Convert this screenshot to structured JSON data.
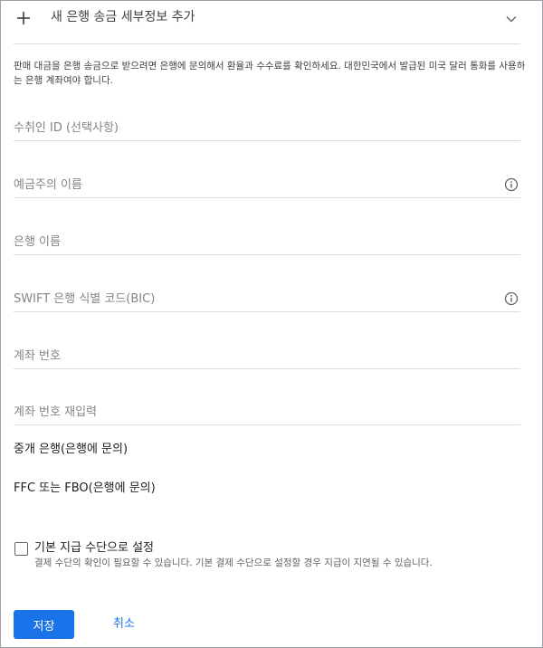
{
  "header": {
    "title": "새 은행 송금 세부정보 추가",
    "expand_icon": "plus-icon",
    "collapse_icon": "chevron-down-icon"
  },
  "description": "판매 대금을 은행 송금으로 받으려면 은행에 문의해서 환율과 수수료를 확인하세요. 대한민국에서 발급된 미국 달러 통화를 사용하는 은행 계좌여야 합니다.",
  "form": {
    "recipient_id": {
      "placeholder": "수취인 ID (선택사항)",
      "value": ""
    },
    "account_holder_name": {
      "placeholder": "예금주의 이름",
      "value": "",
      "icon": "info-icon"
    },
    "bank_name": {
      "placeholder": "은행 이름",
      "value": ""
    },
    "swift_code": {
      "placeholder": "SWIFT 은행 식별 코드(BIC)",
      "value": "",
      "icon": "info-icon"
    },
    "account_number": {
      "placeholder": "계좌 번호",
      "value": ""
    },
    "account_number_confirm": {
      "placeholder": "계좌 번호 재입력",
      "value": ""
    }
  },
  "sections": {
    "intermediary_bank": "중개 은행(은행에 문의)",
    "ffc_fbo": "FFC 또는 FBO(은행에 문의)"
  },
  "default_payment": {
    "label": "기본 지급 수단으로 설정",
    "help": "결제 수단의 확인이 필요할 수 있습니다. 기본 결제 수단으로 설정할 경우 지급이 지연될 수 있습니다.",
    "checked": false
  },
  "actions": {
    "save_label": "저장",
    "cancel_label": "취소"
  },
  "colors": {
    "primary": "#1a73e8",
    "divider": "#dadce0",
    "placeholder": "#80868b"
  }
}
